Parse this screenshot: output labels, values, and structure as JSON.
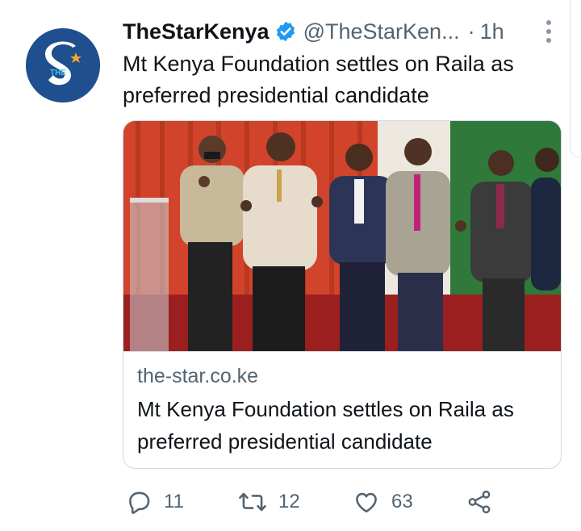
{
  "tweet": {
    "author_name": "TheStarKenya",
    "handle": "@TheStarKen...",
    "separator": "·",
    "time": "1h",
    "text": "Mt Kenya Foundation settles on Raila as preferred presidential candidate",
    "avatar_letter": "S",
    "avatar_small_text": "THE"
  },
  "card": {
    "domain": "the-star.co.ke",
    "title": "Mt Kenya Foundation settles on Raila as preferred presidential candidate"
  },
  "actions": {
    "replies": "11",
    "retweets": "12",
    "likes": "63"
  },
  "colors": {
    "verified": "#1d9bf0",
    "avatar_bg": "#1f4f8f",
    "muted_text": "#536471",
    "card_border": "#cfd9de"
  }
}
